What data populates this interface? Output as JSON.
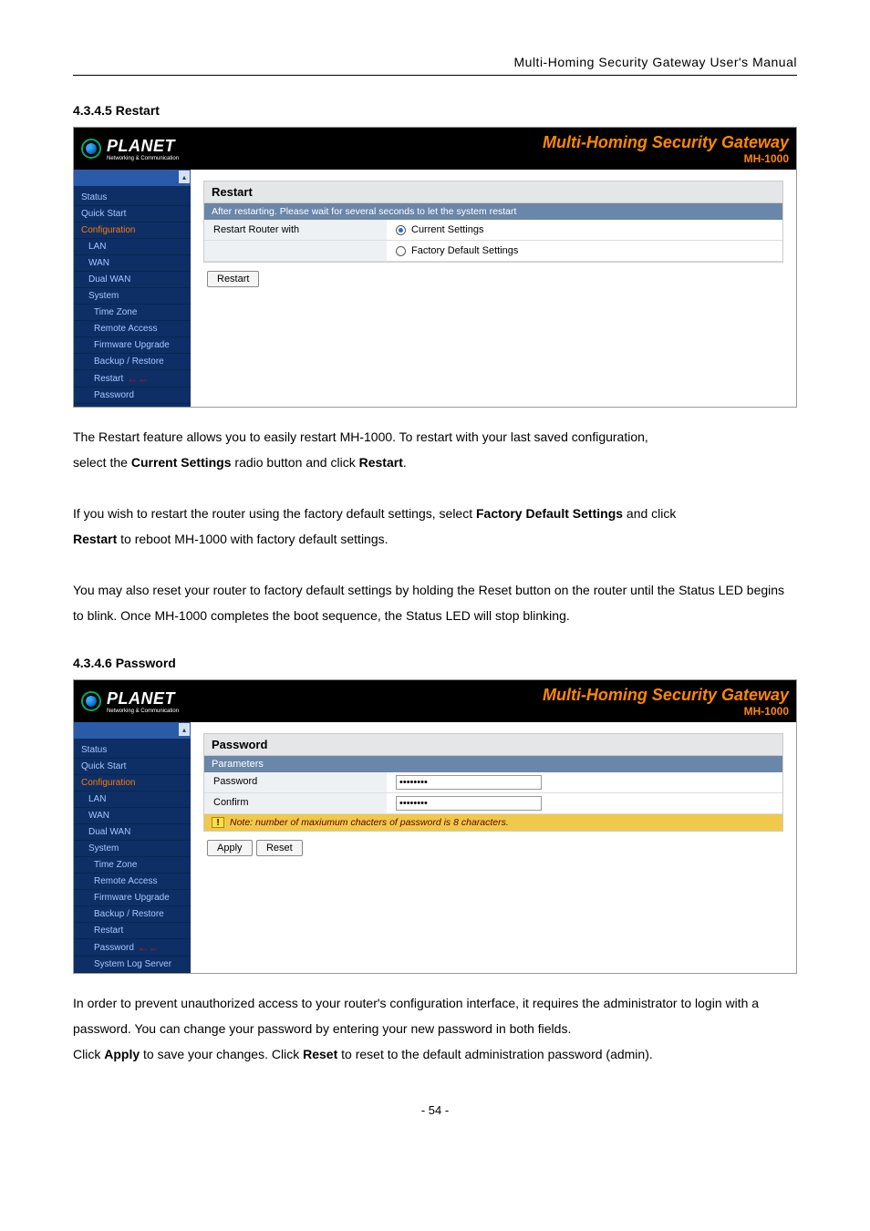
{
  "doc_header": "Multi-Homing  Security  Gateway  User's  Manual",
  "banner": {
    "brand": "PLANET",
    "brand_sub": "Networking & Communication",
    "title": "Multi-Homing Security Gateway",
    "model": "MH-1000"
  },
  "section1": {
    "heading": "4.3.4.5 Restart",
    "nav_top": [
      "Status",
      "Quick Start"
    ],
    "nav_config": "Configuration",
    "nav_sub": [
      "LAN",
      "WAN",
      "Dual WAN",
      "System"
    ],
    "nav_sub2": [
      "Time Zone",
      "Remote Access",
      "Firmware Upgrade",
      "Backup / Restore",
      "Restart",
      "Password"
    ],
    "panel_title": "Restart",
    "panel_msg": "After restarting. Please wait for several seconds to let the system restart",
    "row_label": "Restart Router with",
    "opt1": "Current Settings",
    "opt2": "Factory Default Settings",
    "btn": "Restart",
    "para1a": "The Restart feature allows you to easily restart MH-1000. To restart with your last saved configuration,",
    "para1b_a": "select the ",
    "para1b_b": "Current Settings",
    "para1b_c": " radio button and click ",
    "para1b_d": "Restart",
    "para1b_e": ".",
    "para2a": "If you wish to restart the router using the factory default settings, select ",
    "para2b": "Factory Default Settings",
    "para2c": " and click",
    "para3a": "Restart",
    "para3b": " to reboot MH-1000 with factory default settings.",
    "para4": "You may also reset your router to factory default settings by holding the Reset button on the router until the Status LED begins to blink. Once MH-1000 completes the boot sequence, the Status LED will stop blinking."
  },
  "section2": {
    "heading": "4.3.4.6 Password",
    "nav_top": [
      "Status",
      "Quick Start"
    ],
    "nav_config": "Configuration",
    "nav_sub": [
      "LAN",
      "WAN",
      "Dual WAN",
      "System"
    ],
    "nav_sub2": [
      "Time Zone",
      "Remote Access",
      "Firmware Upgrade",
      "Backup / Restore",
      "Restart",
      "Password",
      "System Log Server"
    ],
    "panel_title": "Password",
    "param_header": "Parameters",
    "row1": "Password",
    "row2": "Confirm",
    "masked": "••••••••",
    "note": "Note: number of maxiumum chacters of password is 8 characters.",
    "btn1": "Apply",
    "btn2": "Reset",
    "para1": "In order to prevent unauthorized access to your router's configuration interface, it requires the administrator to login with a password. You can change your password by entering your new password in both fields.",
    "para2a": "Click ",
    "para2b": "Apply",
    "para2c": " to save your changes. Click ",
    "para2d": "Reset",
    "para2e": " to reset to the default administration password (admin)."
  },
  "page_number": "- 54 -"
}
